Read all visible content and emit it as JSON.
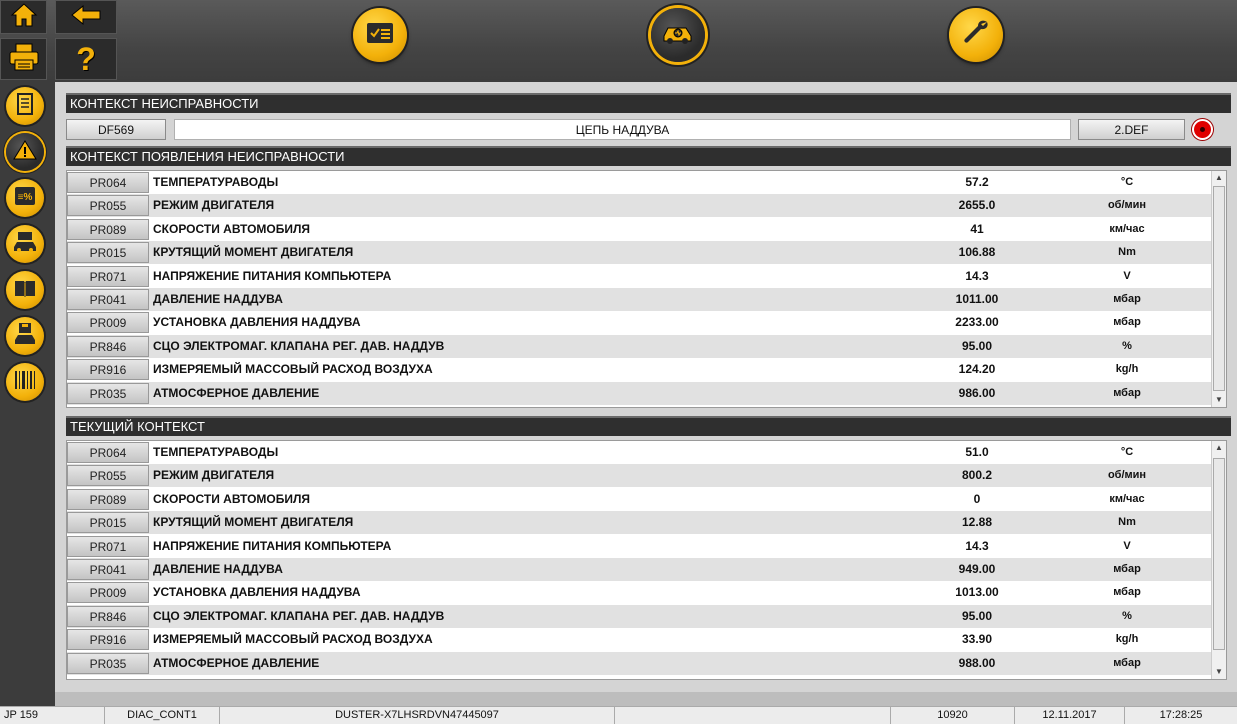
{
  "fault_context": {
    "header": "КОНТЕКСТ НЕИСПРАВНОСТИ",
    "code": "DF569",
    "description": "ЦЕПЬ НАДДУВА",
    "status": "2.DEF"
  },
  "appearance_context": {
    "header": "КОНТЕКСТ ПОЯВЛЕНИЯ НЕИСПРАВНОСТИ",
    "rows": [
      {
        "code": "PR064",
        "name": "ТЕМПЕРАТУРАВОДЫ",
        "value": "57.2",
        "unit": "°C"
      },
      {
        "code": "PR055",
        "name": "РЕЖИМ ДВИГАТЕЛЯ",
        "value": "2655.0",
        "unit": "об/мин"
      },
      {
        "code": "PR089",
        "name": "СКОРОСТИ АВТОМОБИЛЯ",
        "value": "41",
        "unit": "км/час"
      },
      {
        "code": "PR015",
        "name": "КРУТЯЩИЙ МОМЕНТ ДВИГАТЕЛЯ",
        "value": "106.88",
        "unit": "Nm"
      },
      {
        "code": "PR071",
        "name": "НАПРЯЖЕНИЕ ПИТАНИЯ КОМПЬЮТЕРА",
        "value": "14.3",
        "unit": "V"
      },
      {
        "code": "PR041",
        "name": "ДАВЛЕНИЕ НАДДУВА",
        "value": "1011.00",
        "unit": "мбар"
      },
      {
        "code": "PR009",
        "name": "УСТАНОВКА ДАВЛЕНИЯ НАДДУВА",
        "value": "2233.00",
        "unit": "мбар"
      },
      {
        "code": "PR846",
        "name": "СЦО ЭЛЕКТРОМАГ. КЛАПАНА РЕГ. ДАВ. НАДДУВ",
        "value": "95.00",
        "unit": "%"
      },
      {
        "code": "PR916",
        "name": "ИЗМЕРЯЕМЫЙ МАССОВЫЙ РАСХОД ВОЗДУХА",
        "value": "124.20",
        "unit": "kg/h"
      },
      {
        "code": "PR035",
        "name": "АТМОСФЕРНОЕ ДАВЛЕНИЕ",
        "value": "986.00",
        "unit": "мбар"
      }
    ]
  },
  "current_context": {
    "header": "ТЕКУЩИЙ КОНТЕКСТ",
    "rows": [
      {
        "code": "PR064",
        "name": "ТЕМПЕРАТУРАВОДЫ",
        "value": "51.0",
        "unit": "°C"
      },
      {
        "code": "PR055",
        "name": "РЕЖИМ ДВИГАТЕЛЯ",
        "value": "800.2",
        "unit": "об/мин"
      },
      {
        "code": "PR089",
        "name": "СКОРОСТИ АВТОМОБИЛЯ",
        "value": "0",
        "unit": "км/час"
      },
      {
        "code": "PR015",
        "name": "КРУТЯЩИЙ МОМЕНТ ДВИГАТЕЛЯ",
        "value": "12.88",
        "unit": "Nm"
      },
      {
        "code": "PR071",
        "name": "НАПРЯЖЕНИЕ ПИТАНИЯ КОМПЬЮТЕРА",
        "value": "14.3",
        "unit": "V"
      },
      {
        "code": "PR041",
        "name": "ДАВЛЕНИЕ НАДДУВА",
        "value": "949.00",
        "unit": "мбар"
      },
      {
        "code": "PR009",
        "name": "УСТАНОВКА ДАВЛЕНИЯ НАДДУВА",
        "value": "1013.00",
        "unit": "мбар"
      },
      {
        "code": "PR846",
        "name": "СЦО ЭЛЕКТРОМАГ. КЛАПАНА РЕГ. ДАВ. НАДДУВ",
        "value": "95.00",
        "unit": "%"
      },
      {
        "code": "PR916",
        "name": "ИЗМЕРЯЕМЫЙ МАССОВЫЙ РАСХОД ВОЗДУХА",
        "value": "33.90",
        "unit": "kg/h"
      },
      {
        "code": "PR035",
        "name": "АТМОСФЕРНОЕ ДАВЛЕНИЕ",
        "value": "988.00",
        "unit": "мбар"
      }
    ]
  },
  "status_bar": {
    "left": "JP 159",
    "module": "DIAC_CONT1",
    "vin": "DUSTER-X7LHSRDVN47445097",
    "number": "10920",
    "date": "12.11.2017",
    "time": "17:28:25"
  },
  "icons": {
    "top": [
      "home-icon",
      "back-arrow-icon",
      "printer-icon",
      "help-icon",
      "checklist-icon",
      "car-diagnostic-icon",
      "wrench-icon"
    ],
    "sidebar": [
      "document-icon",
      "warning-icon",
      "parameters-percent-icon",
      "car-ecu-icon",
      "manual-book-icon",
      "car-save-icon",
      "barcode-icon"
    ]
  },
  "colors": {
    "accent": "#f3b10a",
    "fault_indicator": "#e00000",
    "header_bg": "#2f2f2f"
  }
}
